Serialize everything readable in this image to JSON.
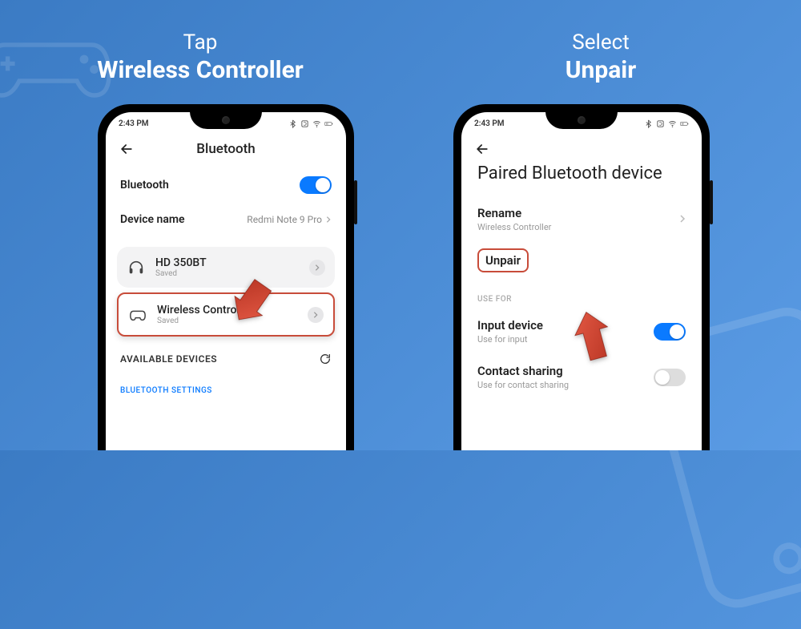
{
  "captions": {
    "left": {
      "line1": "Tap",
      "line2": "Wireless Controller"
    },
    "right": {
      "line1": "Select",
      "line2": "Unpair"
    }
  },
  "status": {
    "time": "2:43 PM"
  },
  "screen1": {
    "title": "Bluetooth",
    "bluetooth_label": "Bluetooth",
    "device_name_label": "Device name",
    "device_name_value": "Redmi Note 9 Pro",
    "devices": [
      {
        "name": "HD 350BT",
        "sub": "Saved"
      },
      {
        "name": "Wireless Controller",
        "sub": "Saved"
      }
    ],
    "available_header": "AVAILABLE DEVICES",
    "bt_settings_header": "BLUETOOTH SETTINGS"
  },
  "screen2": {
    "title": "Paired Bluetooth device",
    "rename_label": "Rename",
    "rename_value": "Wireless Controller",
    "unpair_label": "Unpair",
    "use_for_header": "USE FOR",
    "input_label": "Input device",
    "input_sub": "Use for input",
    "contact_label": "Contact sharing",
    "contact_sub": "Use for contact sharing"
  },
  "colors": {
    "accent": "#0a7aff",
    "highlight_border": "#c84c3a"
  }
}
